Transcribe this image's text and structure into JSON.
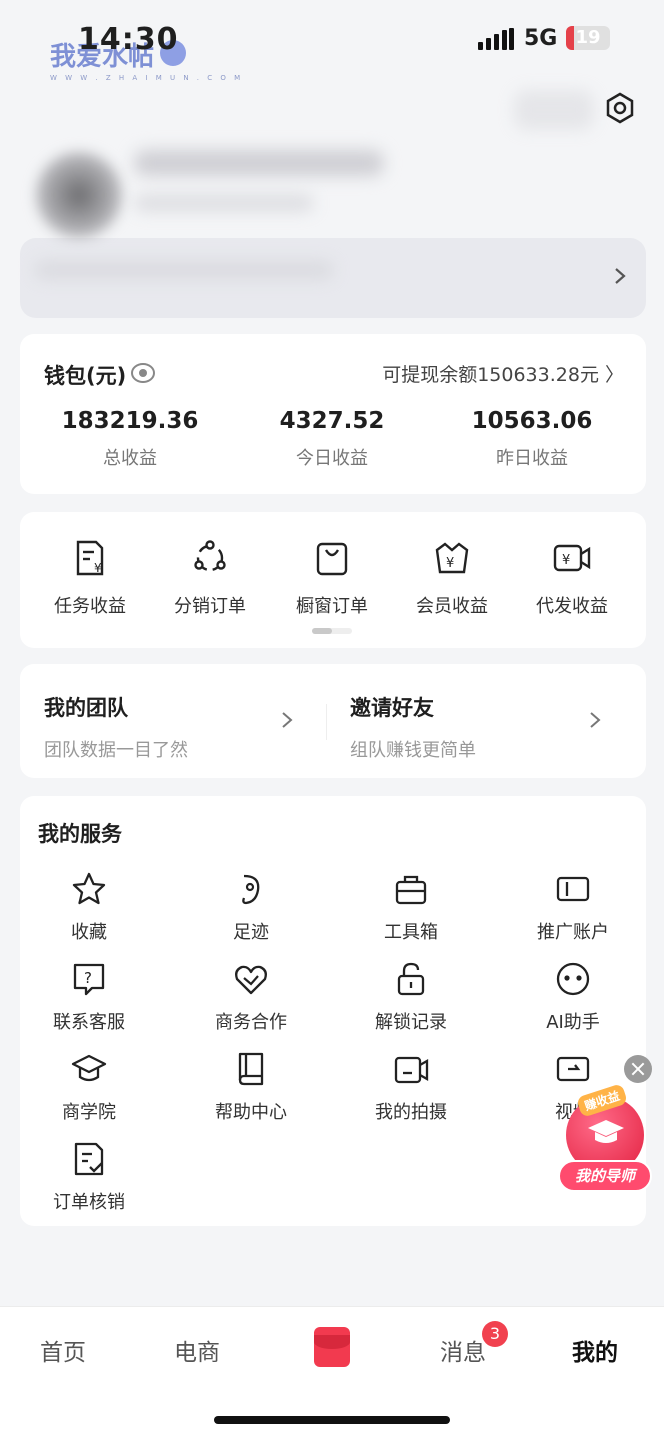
{
  "status_bar": {
    "time": "14:30",
    "network": "5G",
    "battery_level": "19",
    "battery_fraction": 0.19,
    "watermark_text": "我爱水帖",
    "watermark_sub": "W W W . Z H A I M U N . C O M"
  },
  "profile": {
    "settings_icon": "gear-icon",
    "chevron_icon": "chevron-right-icon"
  },
  "wallet": {
    "title": "钱包(元)",
    "eye_icon": "eye-icon",
    "withdraw_text": "可提现余额150633.28元 〉",
    "stats": [
      {
        "value": "183219.36",
        "label": "总收益"
      },
      {
        "value": "4327.52",
        "label": "今日收益"
      },
      {
        "value": "10563.06",
        "label": "昨日收益"
      }
    ]
  },
  "shortcuts": [
    {
      "label": "任务收益",
      "icon": "task-income-icon"
    },
    {
      "label": "分销订单",
      "icon": "distribution-icon"
    },
    {
      "label": "橱窗订单",
      "icon": "shopping-bag-icon"
    },
    {
      "label": "会员收益",
      "icon": "member-income-icon"
    },
    {
      "label": "代发收益",
      "icon": "video-income-icon"
    }
  ],
  "team": {
    "left_title": "我的团队",
    "left_sub": "团队数据一目了然",
    "right_title": "邀请好友",
    "right_sub": "组队赚钱更简单"
  },
  "services": {
    "title": "我的服务",
    "items": [
      {
        "label": "收藏",
        "icon": "star-icon"
      },
      {
        "label": "足迹",
        "icon": "footprint-icon"
      },
      {
        "label": "工具箱",
        "icon": "toolbox-icon"
      },
      {
        "label": "推广账户",
        "icon": "promo-account-icon"
      },
      {
        "label": "联系客服",
        "icon": "help-chat-icon"
      },
      {
        "label": "商务合作",
        "icon": "handshake-icon"
      },
      {
        "label": "解锁记录",
        "icon": "unlock-icon"
      },
      {
        "label": "AI助手",
        "icon": "ai-assistant-icon"
      },
      {
        "label": "商学院",
        "icon": "graduation-cap-icon"
      },
      {
        "label": "帮助中心",
        "icon": "book-icon"
      },
      {
        "label": "我的拍摄",
        "icon": "camera-icon"
      },
      {
        "label": "视频",
        "icon": "video-icon"
      },
      {
        "label": "订单核销",
        "icon": "order-verify-icon"
      }
    ]
  },
  "floating": {
    "tag": "赚收益",
    "button_label": "我的导师"
  },
  "tabbar": {
    "tabs": [
      {
        "label": "首页"
      },
      {
        "label": "电商"
      },
      {
        "label": ""
      },
      {
        "label": "消息"
      },
      {
        "label": "我的"
      }
    ],
    "message_badge": "3"
  },
  "colors": {
    "accent": "#f23a4f",
    "background": "#f4f5f7"
  }
}
